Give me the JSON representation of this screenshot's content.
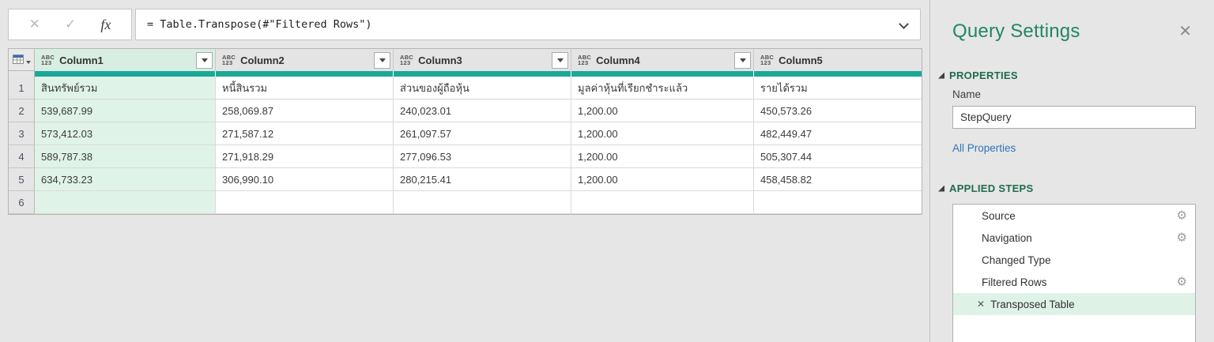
{
  "formula_bar": {
    "cancel_icon": "✕",
    "check_icon": "✓",
    "fx_label": "fx",
    "formula": "= Table.Transpose(#\"Filtered Rows\")"
  },
  "grid": {
    "type_icon": {
      "top": "ABC",
      "bottom": "123"
    },
    "columns": [
      {
        "name": "Column1",
        "selected": true
      },
      {
        "name": "Column2",
        "selected": false
      },
      {
        "name": "Column3",
        "selected": false
      },
      {
        "name": "Column4",
        "selected": false
      },
      {
        "name": "Column5",
        "selected": false
      }
    ],
    "rows": [
      {
        "num": "1",
        "cells": [
          "สินทรัพย์รวม",
          "หนี้สินรวม",
          "ส่วนของผู้ถือหุ้น",
          "มูลค่าหุ้นที่เรียกชำระแล้ว",
          "รายได้รวม"
        ]
      },
      {
        "num": "2",
        "cells": [
          "539,687.99",
          "258,069.87",
          "240,023.01",
          "1,200.00",
          "450,573.26"
        ]
      },
      {
        "num": "3",
        "cells": [
          "573,412.03",
          "271,587.12",
          "261,097.57",
          "1,200.00",
          "482,449.47"
        ]
      },
      {
        "num": "4",
        "cells": [
          "589,787.38",
          "271,918.29",
          "277,096.53",
          "1,200.00",
          "505,307.44"
        ]
      },
      {
        "num": "5",
        "cells": [
          "634,733.23",
          "306,990.10",
          "280,215.41",
          "1,200.00",
          "458,458.82"
        ]
      },
      {
        "num": "6",
        "cells": [
          "",
          "",
          "",
          "",
          ""
        ]
      }
    ]
  },
  "panel": {
    "title": "Query Settings",
    "close_icon": "✕",
    "properties": {
      "header": "PROPERTIES",
      "name_label": "Name",
      "name_value": "StepQuery",
      "all_properties_link": "All Properties"
    },
    "applied_steps": {
      "header": "APPLIED STEPS",
      "delete_icon": "✕",
      "gear_icon": "⚙",
      "steps": [
        {
          "label": "Source",
          "gear": true,
          "selected": false
        },
        {
          "label": "Navigation",
          "gear": true,
          "selected": false
        },
        {
          "label": "Changed Type",
          "gear": false,
          "selected": false
        },
        {
          "label": "Filtered Rows",
          "gear": true,
          "selected": false
        },
        {
          "label": "Transposed Table",
          "gear": false,
          "selected": true
        }
      ]
    }
  },
  "colors": {
    "accent_teal": "#1ca897",
    "selected_green": "#dff2e8",
    "title_green": "#218568",
    "section_green": "#1f6c4d",
    "link_blue": "#2e75b6",
    "background_gray": "#e6e6e6"
  }
}
